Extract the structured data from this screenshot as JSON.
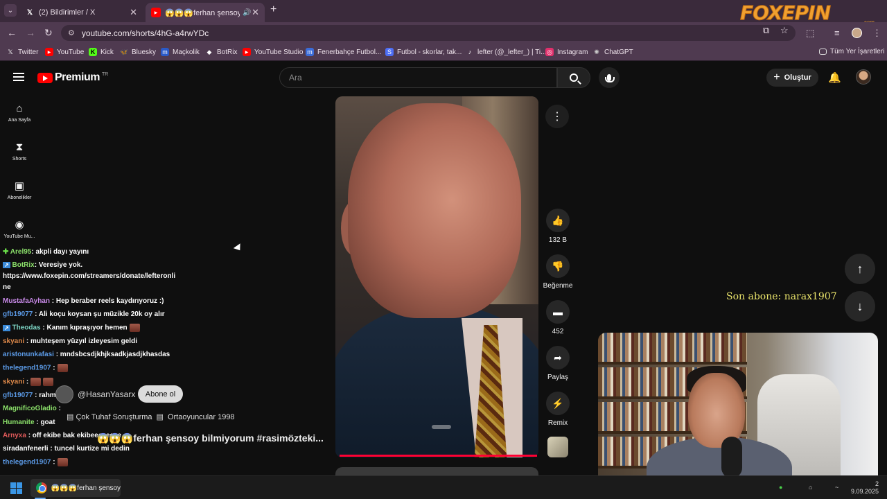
{
  "browser": {
    "tabs": [
      {
        "title": "(2) Bildirimler / X",
        "icon": "x-icon"
      },
      {
        "title": "😱😱😱ferhan şensoy bilm",
        "icon": "youtube-icon"
      }
    ],
    "url": "youtube.com/shorts/4hG-a4rwYDc",
    "bookmarks": [
      {
        "label": "Twitter",
        "icon": "x-icon",
        "color": "#ffffff"
      },
      {
        "label": "YouTube",
        "icon": "youtube-icon",
        "color": "#ff0000"
      },
      {
        "label": "Kick",
        "icon": "kick-icon",
        "color": "#53fc18"
      },
      {
        "label": "Bluesky",
        "icon": "butterfly-icon",
        "color": "#1185fe"
      },
      {
        "label": "Maçkolik",
        "icon": "mackolik-icon",
        "color": "#2a5ac8"
      },
      {
        "label": "BotRix",
        "icon": "botrix-icon",
        "color": "#ffffff"
      },
      {
        "label": "YouTube Studio",
        "icon": "youtube-icon",
        "color": "#ff0000"
      },
      {
        "label": "Fenerbahçe Futbol...",
        "icon": "m-icon",
        "color": "#3b6cd8"
      },
      {
        "label": "Futbol - skorlar, tak...",
        "icon": "s-icon",
        "color": "#4d6ef5"
      },
      {
        "label": "lefter (@_lefter_) | Ti...",
        "icon": "tiktok-icon",
        "color": "#ffffff"
      },
      {
        "label": "Instagram",
        "icon": "instagram-icon",
        "color": "#e1306c"
      },
      {
        "label": "ChatGPT",
        "icon": "chatgpt-icon",
        "color": "#cccccc"
      }
    ],
    "all_bookmarks": "Tüm Yer İşaretleri",
    "overlay_logo": {
      "text": "FOXEPIN",
      "suffix": ".com"
    }
  },
  "youtube": {
    "logo": "Premium",
    "country": "TR",
    "search_placeholder": "Ara",
    "create_label": "Oluştur",
    "sidebar": [
      {
        "label": "Ana Sayfa",
        "icon": "home-icon"
      },
      {
        "label": "Shorts",
        "icon": "shorts-icon"
      },
      {
        "label": "Abonelikler",
        "icon": "subscriptions-icon"
      },
      {
        "label": "YouTube Mu...",
        "icon": "youtube-music-icon"
      }
    ],
    "actions": {
      "likes": "132 B",
      "dislike": "Beğenme",
      "comments": "452",
      "share": "Paylaş",
      "remix": "Remix"
    },
    "channel": "@HasanYasarx",
    "subscribe": "Abone ol",
    "playlist_1": "Çok Tuhaf Soruşturma",
    "playlist_2": "Ortaoyuncular 1998",
    "title": "😱😱😱ferhan şensoy bilmiyorum #rasimözteki..."
  },
  "stream": {
    "last_subscriber": "Son abone: narax1907",
    "chat": [
      {
        "user": "Arel95",
        "text": ": akpli dayı yayını",
        "color": "#8be06a"
      },
      {
        "user": "BotRix",
        "text": ": Veresiye yok.",
        "color": "#8be06a"
      },
      {
        "user": "",
        "text": "https://www.foxepin.com/streamers/donate/lefteronli",
        "color": "#ffffff"
      },
      {
        "user": "",
        "text": "ne",
        "color": "#ffffff"
      },
      {
        "user": "MustafaAyhan",
        "text": ": Hep beraber reels kaydırıyoruz :)",
        "color": "#c88ae8"
      },
      {
        "user": "gfb19077",
        "text": ": Ali koçu koysan şu müzikle 20k oy alır",
        "color": "#5b9ae6"
      },
      {
        "user": "Theodas",
        "text": ": Kanım kıpraşıyor hemen",
        "color": "#7ad0c0"
      },
      {
        "user": "skyani",
        "text": ": muhteşem yüzyıl izleyesim geldi",
        "color": "#e08a4a"
      },
      {
        "user": "aristonunkafasi",
        "text": ": mndsbcsdjkhjksadkjasdjkhasdas",
        "color": "#5b9ae6"
      },
      {
        "user": "thelegend1907",
        "text": ":",
        "color": "#5b9ae6"
      },
      {
        "user": "skyani",
        "text": ":",
        "color": "#e08a4a"
      },
      {
        "user": "gfb19077",
        "text": ": rahmetli",
        "color": "#5b9ae6"
      },
      {
        "user": "MagnificoGladio",
        "text": ":",
        "color": "#8be06a"
      },
      {
        "user": "Humanite",
        "text": ": goat",
        "color": "#8be06a"
      },
      {
        "user": "Arnyxa",
        "text": ": off ekibe bak ekibeeeeeeee",
        "color": "#e05a5a"
      },
      {
        "user": "siradanfenerli",
        "text": ": tuncel kurtize mi dedin",
        "color": "#ffffff"
      },
      {
        "user": "thelegend1907",
        "text": ":",
        "color": "#5b9ae6"
      }
    ]
  },
  "taskbar": {
    "app_label": "😱😱😱ferhan şensoy",
    "time_partial": "2",
    "date": "9.09.2025"
  }
}
